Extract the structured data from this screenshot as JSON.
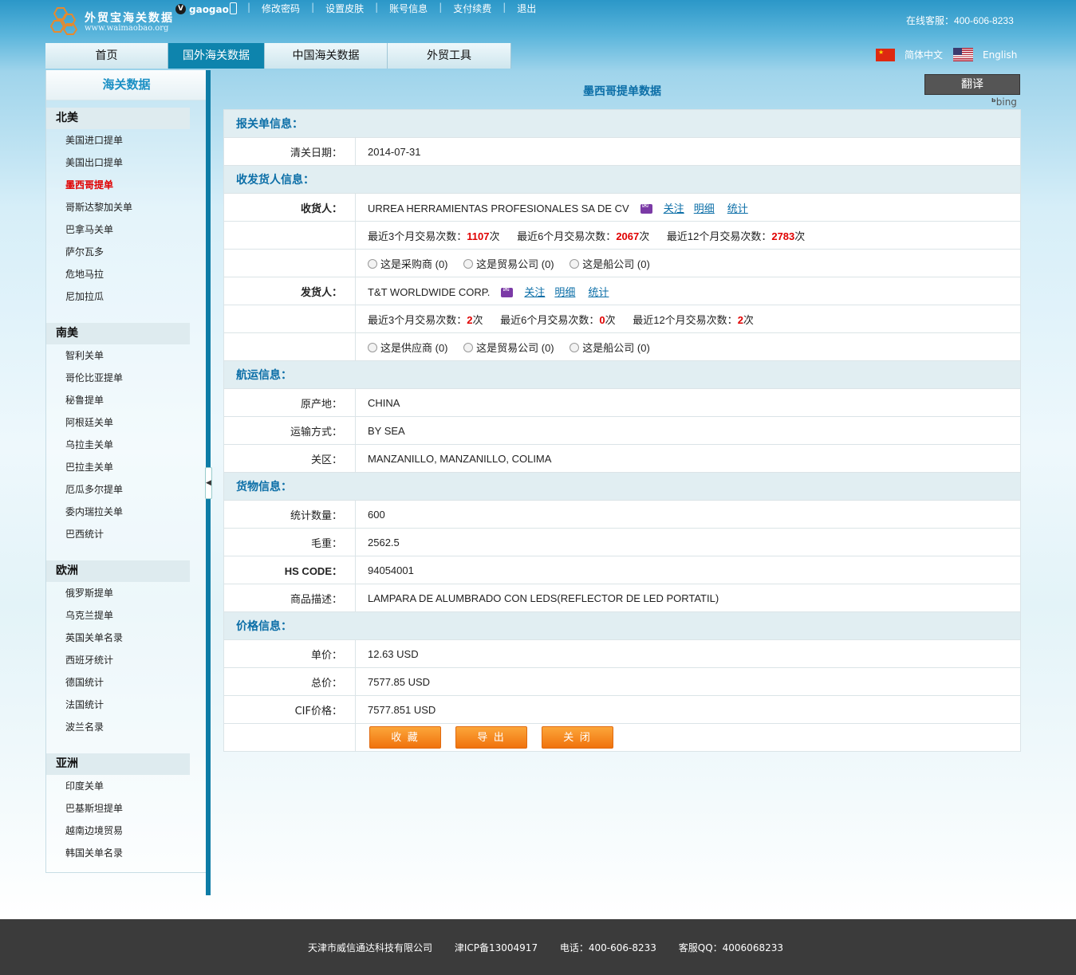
{
  "header": {
    "logo_title": "外贸宝海关数据",
    "logo_url": "www.waimaobao.org",
    "vip_badge": "V",
    "username": "gaogao",
    "links": [
      "修改密码",
      "设置皮肤",
      "账号信息",
      "支付续费",
      "退出"
    ],
    "hotline_label": "在线客服：",
    "hotline_number": "400-606-8233",
    "lang_cn": "简体中文",
    "lang_en": "English"
  },
  "nav": {
    "tabs": [
      "首页",
      "国外海关数据",
      "中国海关数据",
      "外贸工具"
    ],
    "active_index": 1
  },
  "sidebar": {
    "title": "海关数据",
    "regions": [
      {
        "name": "北美",
        "items": [
          "美国进口提单",
          "美国出口提单",
          "墨西哥提单",
          "哥斯达黎加关单",
          "巴拿马关单",
          "萨尔瓦多",
          "危地马拉",
          "尼加拉瓜"
        ]
      },
      {
        "name": "南美",
        "items": [
          "智利关单",
          "哥伦比亚提单",
          "秘鲁提单",
          "阿根廷关单",
          "乌拉圭关单",
          "巴拉圭关单",
          "厄瓜多尔提单",
          "委内瑞拉关单",
          "巴西统计"
        ]
      },
      {
        "name": "欧洲",
        "items": [
          "俄罗斯提单",
          "乌克兰提单",
          "英国关单名录",
          "西班牙统计",
          "德国统计",
          "法国统计",
          "波兰名录"
        ]
      },
      {
        "name": "亚洲",
        "items": [
          "印度关单",
          "巴基斯坦提单",
          "越南边境贸易",
          "韩国关单名录"
        ]
      }
    ],
    "active_item": "墨西哥提单"
  },
  "main": {
    "page_title": "墨西哥提单数据",
    "translate_label": "翻译",
    "bing_label": "bing",
    "sections": {
      "customs": "报关单信息：",
      "parties": "收发货人信息：",
      "shipping": "航运信息：",
      "goods": "货物信息：",
      "price": "价格信息："
    },
    "fields": {
      "clear_date_label": "清关日期：",
      "clear_date": "2014-07-31",
      "consignee_label": "收货人：",
      "consignee": "URREA HERRAMIENTAS PROFESIONALES SA DE CV",
      "shipper_label": "发货人：",
      "shipper": "T&T WORLDWIDE CORP.",
      "origin_label": "原产地：",
      "origin": "CHINA",
      "transport_label": "运输方式：",
      "transport": "BY SEA",
      "customs_area_label": "关区：",
      "customs_area": "MANZANILLO, MANZANILLO, COLIMA",
      "quantity_label": "统计数量：",
      "quantity": "600",
      "gross_weight_label": "毛重：",
      "gross_weight": "2562.5",
      "hs_code_label": "HS CODE：",
      "hs_code": "94054001",
      "description_label": "商品描述：",
      "description": "LAMPARA DE ALUMBRADO CON LEDS(REFLECTOR DE LED PORTATIL)",
      "unit_price_label": "单价：",
      "unit_price": "12.63 USD",
      "total_price_label": "总价：",
      "total_price": "7577.85 USD",
      "cif_label": "CIF价格：",
      "cif_price": "7577.851 USD"
    },
    "actions": {
      "follow": "关注",
      "detail": "明细",
      "stats": "统计"
    },
    "trade_labels": {
      "m3": "最近3个月交易次数：",
      "m6": "最近6个月交易次数：",
      "m12": "最近12个月交易次数：",
      "unit": "次"
    },
    "consignee_stats": {
      "m3": "1107",
      "m6": "2067",
      "m12": "2783"
    },
    "shipper_stats": {
      "m3": "2",
      "m6": "0",
      "m12": "2"
    },
    "consignee_radios": [
      "这是采购商 (0)",
      "这是贸易公司 (0)",
      "这是船公司 (0)"
    ],
    "shipper_radios": [
      "这是供应商 (0)",
      "这是贸易公司 (0)",
      "这是船公司 (0)"
    ],
    "buttons": [
      "收 藏",
      "导 出",
      "关 闭"
    ]
  },
  "footer": {
    "company": "天津市威信通达科技有限公司",
    "icp": "津ICP备13004917",
    "phone": "电话：400-606-8233",
    "qq": "客服QQ：4006068233"
  }
}
